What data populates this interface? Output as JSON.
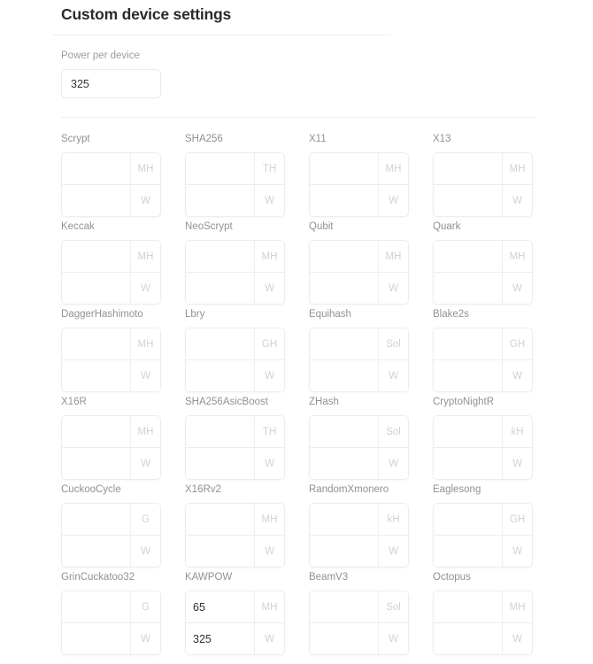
{
  "header": {
    "title": "Custom device settings"
  },
  "power": {
    "label": "Power per device",
    "value": "325",
    "placeholder": ""
  },
  "units": {
    "power": "W"
  },
  "algorithms": [
    {
      "name": "Scrypt",
      "hash_unit": "MH",
      "hash_value": "",
      "power_unit": "W",
      "power_value": ""
    },
    {
      "name": "SHA256",
      "hash_unit": "TH",
      "hash_value": "",
      "power_unit": "W",
      "power_value": ""
    },
    {
      "name": "X11",
      "hash_unit": "MH",
      "hash_value": "",
      "power_unit": "W",
      "power_value": ""
    },
    {
      "name": "X13",
      "hash_unit": "MH",
      "hash_value": "",
      "power_unit": "W",
      "power_value": ""
    },
    {
      "name": "Keccak",
      "hash_unit": "MH",
      "hash_value": "",
      "power_unit": "W",
      "power_value": ""
    },
    {
      "name": "NeoScrypt",
      "hash_unit": "MH",
      "hash_value": "",
      "power_unit": "W",
      "power_value": ""
    },
    {
      "name": "Qubit",
      "hash_unit": "MH",
      "hash_value": "",
      "power_unit": "W",
      "power_value": ""
    },
    {
      "name": "Quark",
      "hash_unit": "MH",
      "hash_value": "",
      "power_unit": "W",
      "power_value": ""
    },
    {
      "name": "DaggerHashimoto",
      "hash_unit": "MH",
      "hash_value": "",
      "power_unit": "W",
      "power_value": ""
    },
    {
      "name": "Lbry",
      "hash_unit": "GH",
      "hash_value": "",
      "power_unit": "W",
      "power_value": ""
    },
    {
      "name": "Equihash",
      "hash_unit": "Sol",
      "hash_value": "",
      "power_unit": "W",
      "power_value": ""
    },
    {
      "name": "Blake2s",
      "hash_unit": "GH",
      "hash_value": "",
      "power_unit": "W",
      "power_value": ""
    },
    {
      "name": "X16R",
      "hash_unit": "MH",
      "hash_value": "",
      "power_unit": "W",
      "power_value": ""
    },
    {
      "name": "SHA256AsicBoost",
      "hash_unit": "TH",
      "hash_value": "",
      "power_unit": "W",
      "power_value": ""
    },
    {
      "name": "ZHash",
      "hash_unit": "Sol",
      "hash_value": "",
      "power_unit": "W",
      "power_value": ""
    },
    {
      "name": "CryptoNightR",
      "hash_unit": "kH",
      "hash_value": "",
      "power_unit": "W",
      "power_value": ""
    },
    {
      "name": "CuckooCycle",
      "hash_unit": "G",
      "hash_value": "",
      "power_unit": "W",
      "power_value": ""
    },
    {
      "name": "X16Rv2",
      "hash_unit": "MH",
      "hash_value": "",
      "power_unit": "W",
      "power_value": ""
    },
    {
      "name": "RandomXmonero",
      "hash_unit": "kH",
      "hash_value": "",
      "power_unit": "W",
      "power_value": ""
    },
    {
      "name": "Eaglesong",
      "hash_unit": "GH",
      "hash_value": "",
      "power_unit": "W",
      "power_value": ""
    },
    {
      "name": "GrinCuckatoo32",
      "hash_unit": "G",
      "hash_value": "",
      "power_unit": "W",
      "power_value": ""
    },
    {
      "name": "KAWPOW",
      "hash_unit": "MH",
      "hash_value": "65",
      "power_unit": "W",
      "power_value": "325"
    },
    {
      "name": "BeamV3",
      "hash_unit": "Sol",
      "hash_value": "",
      "power_unit": "W",
      "power_value": ""
    },
    {
      "name": "Octopus",
      "hash_unit": "MH",
      "hash_value": "",
      "power_unit": "W",
      "power_value": ""
    }
  ]
}
